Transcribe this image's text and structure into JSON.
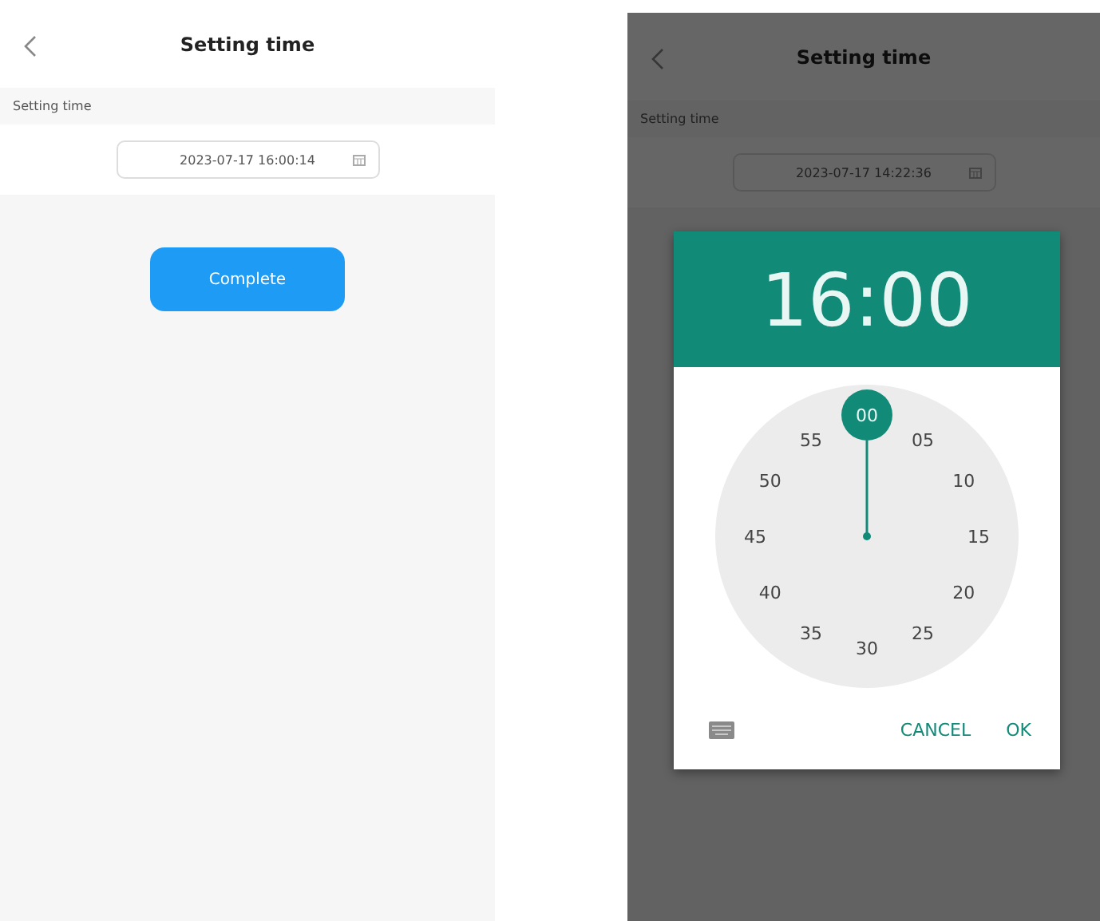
{
  "screens": [
    {
      "title": "Setting time",
      "section_label": "Setting time",
      "datetime_value": "2023-07-17 16:00:14",
      "complete_button": "Complete",
      "dimmed": false
    },
    {
      "title": "Setting time",
      "section_label": "Setting time",
      "datetime_value": "2023-07-17 14:22:36",
      "dimmed": true,
      "time_picker": {
        "time": "16:00",
        "minutes": [
          {
            "label": "00",
            "selected": true
          },
          {
            "label": "05",
            "selected": false
          },
          {
            "label": "10",
            "selected": false
          },
          {
            "label": "15",
            "selected": false
          },
          {
            "label": "20",
            "selected": false
          },
          {
            "label": "25",
            "selected": false
          },
          {
            "label": "30",
            "selected": false
          },
          {
            "label": "35",
            "selected": false
          },
          {
            "label": "40",
            "selected": false
          },
          {
            "label": "45",
            "selected": false
          },
          {
            "label": "50",
            "selected": false
          },
          {
            "label": "55",
            "selected": false
          }
        ],
        "cancel_button": "CANCEL",
        "ok_button": "OK"
      }
    }
  ]
}
